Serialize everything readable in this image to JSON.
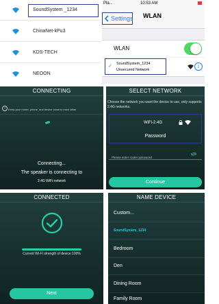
{
  "wifi_list": {
    "networks": [
      {
        "name": "SoundSystem _1234",
        "selected": true
      },
      {
        "name": "ChinaNet-kPu3",
        "selected": false
      },
      {
        "name": "KDS-TECH",
        "selected": false
      },
      {
        "name": "NEOON",
        "selected": false
      }
    ],
    "icon": "wifi-icon",
    "accent": "#1e8fe1"
  },
  "ios_wlan": {
    "status_left": "Pla... ",
    "status_time": "10:53 AM",
    "back_label": "Settings",
    "title": "WLAN",
    "wlan_label": "WLAN",
    "toggle_on": true,
    "network_name": "SoundSystem_1234",
    "network_sub": "Unsecured Network",
    "info_label": "i",
    "accent": "#157efb",
    "toggle_color": "#4cd964"
  },
  "connecting": {
    "title": "CONNECTING",
    "tip": "Keep your router, phone, and device close to each other",
    "main": "Connecting...",
    "sub": "The speaker is connecting to",
    "sub2": "2.4G WiFi network"
  },
  "select_network": {
    "title": "SELECT NETWORK",
    "desc": "Choose the network you want the device to use, only supports 2.4G networks.",
    "band": "WiFi-2.4G",
    "password_label": "Password",
    "placeholder": "Please enter router password",
    "continue_label": "Continue"
  },
  "connected": {
    "title": "CONNECTED",
    "strength_text": "Current Wi-Fi strength of device:100%",
    "strength_percent": 100,
    "next_label": "Next"
  },
  "name_device": {
    "title": "NAME DEVICE",
    "items": [
      "Custom...",
      "SoundSystem_1234",
      "Bedroom",
      "Den",
      "Dining Room",
      "Family Room"
    ]
  },
  "colors": {
    "teal_accent": "#27c6a3",
    "highlight_box": "#2b3d8f",
    "dark_bg": "#1b3533"
  }
}
